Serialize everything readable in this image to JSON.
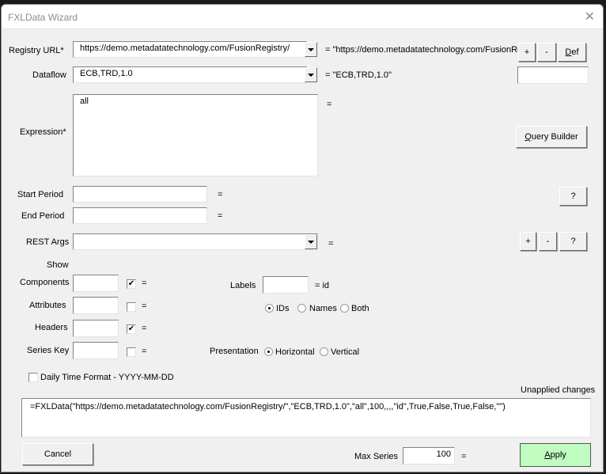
{
  "window": {
    "title": "FXLData Wizard",
    "close_glyph": "✕"
  },
  "registry": {
    "label": "Registry URL*",
    "value": "https://demo.metadatatechnology.com/FusionRegistry/",
    "echo": "= \"https://demo.metadatatechnology.com/FusionRe",
    "add_label": "+",
    "remove_label": "-",
    "def_label": "Def",
    "def_hotkey": "D",
    "def_rest": "ef"
  },
  "dataflow": {
    "label": "Dataflow",
    "value": "ECB,TRD,1.0",
    "echo": "= \"ECB,TRD,1.0\"",
    "side_value": ""
  },
  "expression": {
    "label": "Expression*",
    "value": "all",
    "echo": "=",
    "query_builder_hotkey": "Q",
    "query_builder_rest": "uery Builder"
  },
  "start_period": {
    "label": "Start Period",
    "value": "",
    "echo": "="
  },
  "end_period": {
    "label": "End Period",
    "value": "",
    "echo": "="
  },
  "period_help_label": "?",
  "rest_args": {
    "label": "REST Args",
    "value": "",
    "echo": "=",
    "add_label": "+",
    "remove_label": "-",
    "help_label": "?"
  },
  "show": {
    "heading": "Show",
    "rows": [
      {
        "label": "Components",
        "value": "",
        "checked": true,
        "echo": "="
      },
      {
        "label": "Attributes",
        "value": "",
        "checked": false,
        "echo": "="
      },
      {
        "label": "Headers",
        "value": "",
        "checked": true,
        "echo": "="
      },
      {
        "label": "Series Key",
        "value": "",
        "checked": false,
        "echo": "="
      }
    ]
  },
  "labels": {
    "label": "Labels",
    "value": "",
    "echo": "= id",
    "options": [
      {
        "label": "IDs",
        "selected": true
      },
      {
        "label": "Names",
        "selected": false
      },
      {
        "label": "Both",
        "selected": false
      }
    ]
  },
  "presentation": {
    "label": "Presentation",
    "options": [
      {
        "label": "Horizontal",
        "selected": true
      },
      {
        "label": "Vertical",
        "selected": false
      }
    ]
  },
  "daily_time_format": {
    "label": "Daily Time Format - YYYY-MM-DD",
    "checked": false
  },
  "status": "Unapplied changes",
  "formula": "=FXLData(\"https://demo.metadatatechnology.com/FusionRegistry/\",\"ECB,TRD,1.0\",\"all\",100,,,,\"id\",True,False,True,False,\"\")",
  "footer": {
    "cancel_label": "Cancel",
    "max_series_label": "Max Series",
    "max_series_value": "100",
    "max_series_echo": "=",
    "apply_hotkey": "A",
    "apply_rest": "pply"
  },
  "colors": {
    "apply_bg": "#c0fcc0",
    "dialog_bg": "#f0f0f0"
  }
}
